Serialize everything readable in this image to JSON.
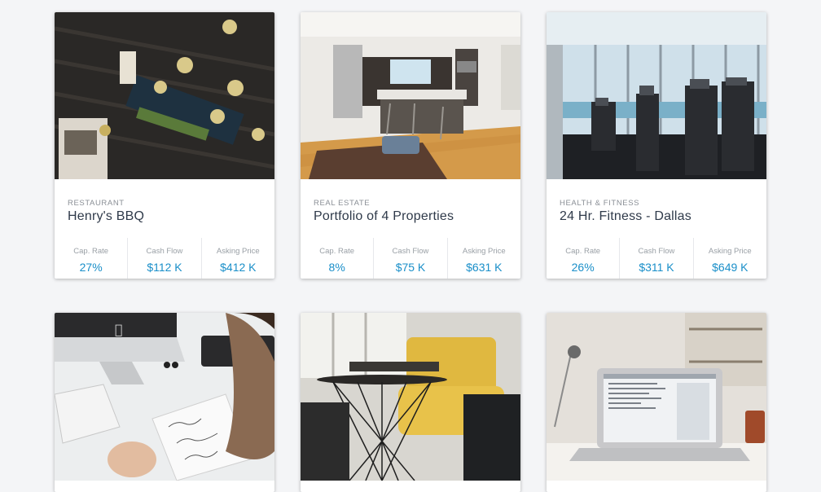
{
  "listings": [
    {
      "category": "RESTAURANT",
      "title": "Henry's BBQ",
      "stats": [
        {
          "label": "Cap. Rate",
          "value": "27%"
        },
        {
          "label": "Cash Flow",
          "value": "$112 K"
        },
        {
          "label": "Asking Price",
          "value": "$412 K"
        }
      ]
    },
    {
      "category": "REAL ESTATE",
      "title": "Portfolio of 4 Properties",
      "stats": [
        {
          "label": "Cap. Rate",
          "value": "8%"
        },
        {
          "label": "Cash Flow",
          "value": "$75 K"
        },
        {
          "label": "Asking Price",
          "value": "$631 K"
        }
      ]
    },
    {
      "category": "HEALTH & FITNESS",
      "title": "24 Hr. Fitness - Dallas",
      "stats": [
        {
          "label": "Cap. Rate",
          "value": "26%"
        },
        {
          "label": "Cash Flow",
          "value": "$311 K"
        },
        {
          "label": "Asking Price",
          "value": "$649 K"
        }
      ]
    }
  ],
  "colors": {
    "accent": "#1a8fc9",
    "title": "#2f3a4a",
    "muted": "#8a8f96"
  },
  "photos": [
    "restaurant-photo",
    "kitchen-photo",
    "gym-photo",
    "office-writing-photo",
    "living-room-photo",
    "laptop-desk-photo"
  ]
}
